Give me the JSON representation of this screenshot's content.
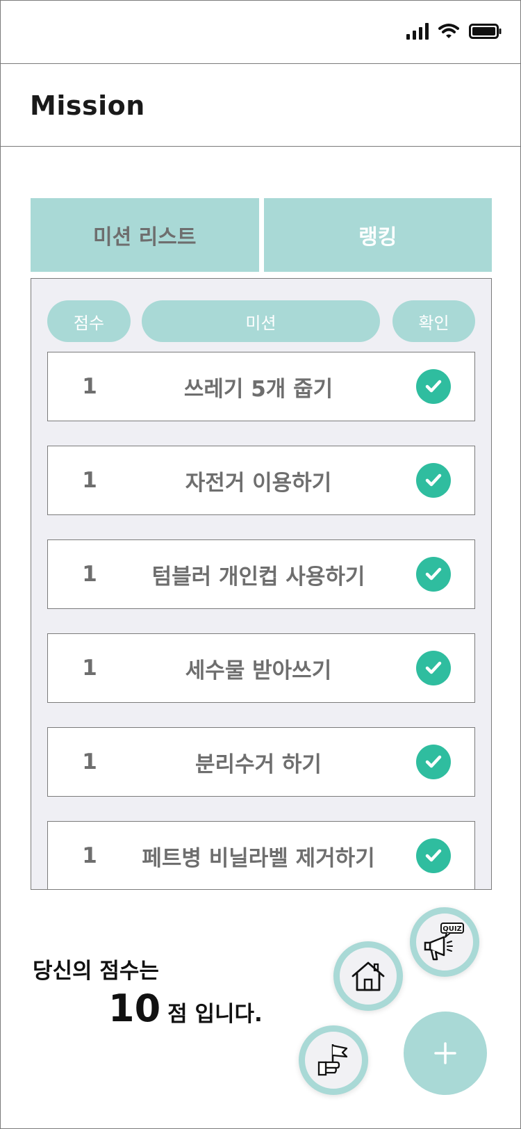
{
  "status_bar": {
    "icons": [
      "signal-icon",
      "wifi-icon",
      "battery-icon"
    ]
  },
  "header": {
    "title": "Mission"
  },
  "tabs": [
    {
      "label": "미션 리스트",
      "active": true
    },
    {
      "label": "랭킹",
      "active": false
    }
  ],
  "columns": {
    "score": "점수",
    "mission": "미션",
    "check": "확인"
  },
  "missions": [
    {
      "score": "1",
      "title": "쓰레기 5개 줍기",
      "done": true
    },
    {
      "score": "1",
      "title": "자전거 이용하기",
      "done": true
    },
    {
      "score": "1",
      "title": "텀블러 개인컵 사용하기",
      "done": true
    },
    {
      "score": "1",
      "title": "세수물 받아쓰기",
      "done": true
    },
    {
      "score": "1",
      "title": "분리수거 하기",
      "done": true
    },
    {
      "score": "1",
      "title": "페트병 비닐라벨 제거하기",
      "done": true
    }
  ],
  "score_summary": {
    "label": "당신의 점수는",
    "value": "10",
    "suffix": "점 입니다."
  },
  "fab": {
    "quiz_badge": "QUIZ",
    "icons": [
      "megaphone-quiz-icon",
      "home-icon",
      "flag-hand-icon",
      "plus-icon"
    ]
  },
  "colors": {
    "accent": "#a9d9d6",
    "check": "#2fbd9f",
    "panel_bg": "#efeff4",
    "text_muted": "#6e6e6e"
  }
}
